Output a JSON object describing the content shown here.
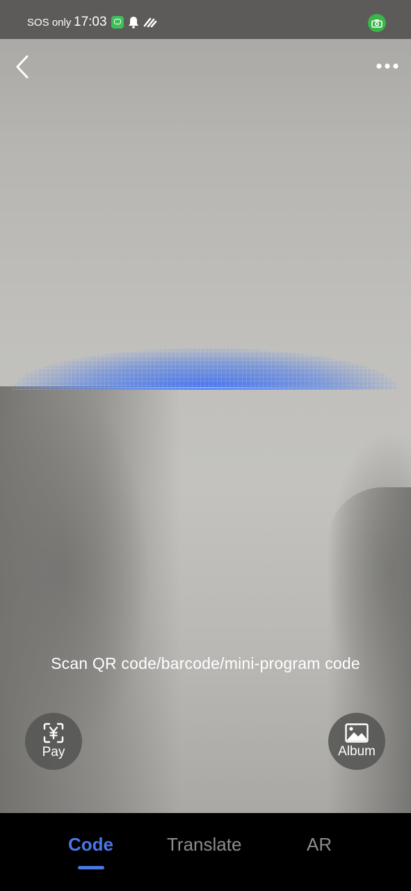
{
  "status_bar": {
    "carrier": "SOS only",
    "time": "17:03"
  },
  "scan_hint": "Scan QR code/barcode/mini-program code",
  "actions": {
    "pay_label": "Pay",
    "album_label": "Album"
  },
  "tabs": [
    {
      "label": "Code",
      "active": true
    },
    {
      "label": "Translate",
      "active": false
    },
    {
      "label": "AR",
      "active": false
    }
  ],
  "colors": {
    "accent": "#4a76e6",
    "scan_line": "#3c6ef0",
    "status_camera": "#39b54a"
  },
  "icons": {
    "back": "chevron-left-icon",
    "more": "more-dots-icon",
    "pay": "yuan-scan-icon",
    "album": "image-icon"
  }
}
